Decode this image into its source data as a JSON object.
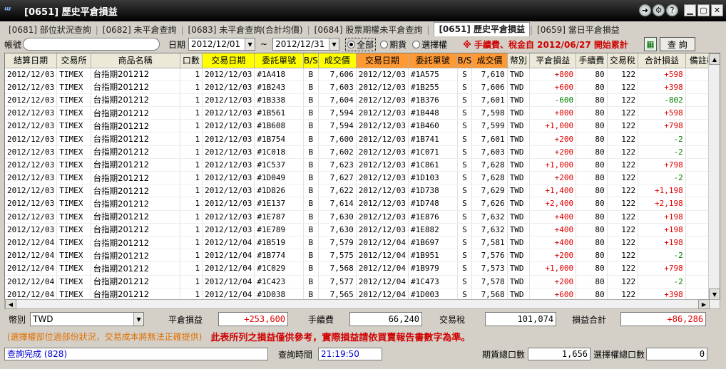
{
  "window": {
    "title": "[0651] 歷史平倉損益",
    "logo": "ᵚ"
  },
  "tabs": [
    {
      "label": "[0681] 部位狀況查詢",
      "active": false
    },
    {
      "label": "[0682] 未平倉查詢",
      "active": false
    },
    {
      "label": "[0683] 未平倉查詢(合計均價)",
      "active": false
    },
    {
      "label": "[0684] 股票期權未平倉查詢",
      "active": false
    },
    {
      "label": "[0651] 歷史平倉損益",
      "active": true
    },
    {
      "label": "[0659] 當日平倉損益",
      "active": false
    }
  ],
  "filter": {
    "account_label": "帳號",
    "account_value": "",
    "date_label": "日期",
    "date_from": "2012/12/01",
    "date_sep": "~",
    "date_to": "2012/12/31",
    "radio_all": "全部",
    "radio_futures": "期貨",
    "radio_options": "選擇權",
    "notice": "※ 手續費、稅金自 2012/06/27 開始累計",
    "query_label": "查  詢"
  },
  "table": {
    "headers": [
      "結算日期",
      "交易所",
      "商品名稱",
      "口數",
      "交易日期",
      "委託單號",
      "B/S",
      "成交價",
      "交易日期",
      "委託單號",
      "B/S",
      "成交價",
      "幣別",
      "平倉損益",
      "手續費",
      "交易稅",
      "合計損益",
      "備註欄"
    ],
    "rows": [
      [
        "2012/12/03",
        "TIMEX",
        "台指期201212",
        "1",
        "2012/12/03",
        "#1A418",
        "B",
        "7,606",
        "2012/12/03",
        "#1A575",
        "S",
        "7,610",
        "TWD",
        "+800",
        "80",
        "122",
        "+598",
        ""
      ],
      [
        "2012/12/03",
        "TIMEX",
        "台指期201212",
        "1",
        "2012/12/03",
        "#1B243",
        "B",
        "7,603",
        "2012/12/03",
        "#1B255",
        "S",
        "7,606",
        "TWD",
        "+600",
        "80",
        "122",
        "+398",
        ""
      ],
      [
        "2012/12/03",
        "TIMEX",
        "台指期201212",
        "1",
        "2012/12/03",
        "#1B338",
        "B",
        "7,604",
        "2012/12/03",
        "#1B376",
        "S",
        "7,601",
        "TWD",
        "-600",
        "80",
        "122",
        "-802",
        ""
      ],
      [
        "2012/12/03",
        "TIMEX",
        "台指期201212",
        "1",
        "2012/12/03",
        "#1B561",
        "B",
        "7,594",
        "2012/12/03",
        "#1B448",
        "S",
        "7,598",
        "TWD",
        "+800",
        "80",
        "122",
        "+598",
        ""
      ],
      [
        "2012/12/03",
        "TIMEX",
        "台指期201212",
        "1",
        "2012/12/03",
        "#1B608",
        "B",
        "7,594",
        "2012/12/03",
        "#1B460",
        "S",
        "7,599",
        "TWD",
        "+1,000",
        "80",
        "122",
        "+798",
        ""
      ],
      [
        "2012/12/03",
        "TIMEX",
        "台指期201212",
        "1",
        "2012/12/03",
        "#1B754",
        "B",
        "7,600",
        "2012/12/03",
        "#1B741",
        "S",
        "7,601",
        "TWD",
        "+200",
        "80",
        "122",
        "-2",
        ""
      ],
      [
        "2012/12/03",
        "TIMEX",
        "台指期201212",
        "1",
        "2012/12/03",
        "#1C018",
        "B",
        "7,602",
        "2012/12/03",
        "#1C071",
        "S",
        "7,603",
        "TWD",
        "+200",
        "80",
        "122",
        "-2",
        ""
      ],
      [
        "2012/12/03",
        "TIMEX",
        "台指期201212",
        "1",
        "2012/12/03",
        "#1C537",
        "B",
        "7,623",
        "2012/12/03",
        "#1C861",
        "S",
        "7,628",
        "TWD",
        "+1,000",
        "80",
        "122",
        "+798",
        ""
      ],
      [
        "2012/12/03",
        "TIMEX",
        "台指期201212",
        "1",
        "2012/12/03",
        "#1D049",
        "B",
        "7,627",
        "2012/12/03",
        "#1D103",
        "S",
        "7,628",
        "TWD",
        "+200",
        "80",
        "122",
        "-2",
        ""
      ],
      [
        "2012/12/03",
        "TIMEX",
        "台指期201212",
        "1",
        "2012/12/03",
        "#1D826",
        "B",
        "7,622",
        "2012/12/03",
        "#1D738",
        "S",
        "7,629",
        "TWD",
        "+1,400",
        "80",
        "122",
        "+1,198",
        ""
      ],
      [
        "2012/12/03",
        "TIMEX",
        "台指期201212",
        "1",
        "2012/12/03",
        "#1E137",
        "B",
        "7,614",
        "2012/12/03",
        "#1D748",
        "S",
        "7,626",
        "TWD",
        "+2,400",
        "80",
        "122",
        "+2,198",
        ""
      ],
      [
        "2012/12/03",
        "TIMEX",
        "台指期201212",
        "1",
        "2012/12/03",
        "#1E787",
        "B",
        "7,630",
        "2012/12/03",
        "#1E876",
        "S",
        "7,632",
        "TWD",
        "+400",
        "80",
        "122",
        "+198",
        ""
      ],
      [
        "2012/12/03",
        "TIMEX",
        "台指期201212",
        "1",
        "2012/12/03",
        "#1E789",
        "B",
        "7,630",
        "2012/12/03",
        "#1E882",
        "S",
        "7,632",
        "TWD",
        "+400",
        "80",
        "122",
        "+198",
        ""
      ],
      [
        "2012/12/04",
        "TIMEX",
        "台指期201212",
        "1",
        "2012/12/04",
        "#1B519",
        "B",
        "7,579",
        "2012/12/04",
        "#1B697",
        "S",
        "7,581",
        "TWD",
        "+400",
        "80",
        "122",
        "+198",
        ""
      ],
      [
        "2012/12/04",
        "TIMEX",
        "台指期201212",
        "1",
        "2012/12/04",
        "#1B774",
        "B",
        "7,575",
        "2012/12/04",
        "#1B951",
        "S",
        "7,576",
        "TWD",
        "+200",
        "80",
        "122",
        "-2",
        ""
      ],
      [
        "2012/12/04",
        "TIMEX",
        "台指期201212",
        "1",
        "2012/12/04",
        "#1C029",
        "B",
        "7,568",
        "2012/12/04",
        "#1B979",
        "S",
        "7,573",
        "TWD",
        "+1,000",
        "80",
        "122",
        "+798",
        ""
      ],
      [
        "2012/12/04",
        "TIMEX",
        "台指期201212",
        "1",
        "2012/12/04",
        "#1C423",
        "B",
        "7,577",
        "2012/12/04",
        "#1C473",
        "S",
        "7,578",
        "TWD",
        "+200",
        "80",
        "122",
        "-2",
        ""
      ],
      [
        "2012/12/04",
        "TIMEX",
        "台指期201212",
        "1",
        "2012/12/04",
        "#1D038",
        "B",
        "7,565",
        "2012/12/04",
        "#1D003",
        "S",
        "7,568",
        "TWD",
        "+600",
        "80",
        "122",
        "+398",
        ""
      ]
    ]
  },
  "totals": {
    "currency_label": "幣別",
    "currency_value": "TWD",
    "pnl_label": "平倉損益",
    "pnl_value": "+253,600",
    "fee_label": "手續費",
    "fee_value": "66,240",
    "tax_label": "交易稅",
    "tax_value": "101,074",
    "net_label": "損益合計",
    "net_value": "+86,286"
  },
  "warnings": {
    "options_note": "(選擇權部位過部份狀況，交易成本將無法正確提供)",
    "disclaimer": "此表所列之損益僅供參考，實際損益請依買賣報告書數字為準。"
  },
  "status": {
    "message": "查詢完成 (828)",
    "time_label": "查詢時間",
    "time_value": "21:19:50",
    "futures_lots_label": "期貨總口數",
    "futures_lots_value": "1,656",
    "options_lots_label": "選擇權總口數",
    "options_lots_value": "0"
  },
  "colors": {
    "header_yellow": "#ffff00",
    "header_orange": "#ff9933",
    "positive": "#e00000",
    "negative": "#008000"
  }
}
